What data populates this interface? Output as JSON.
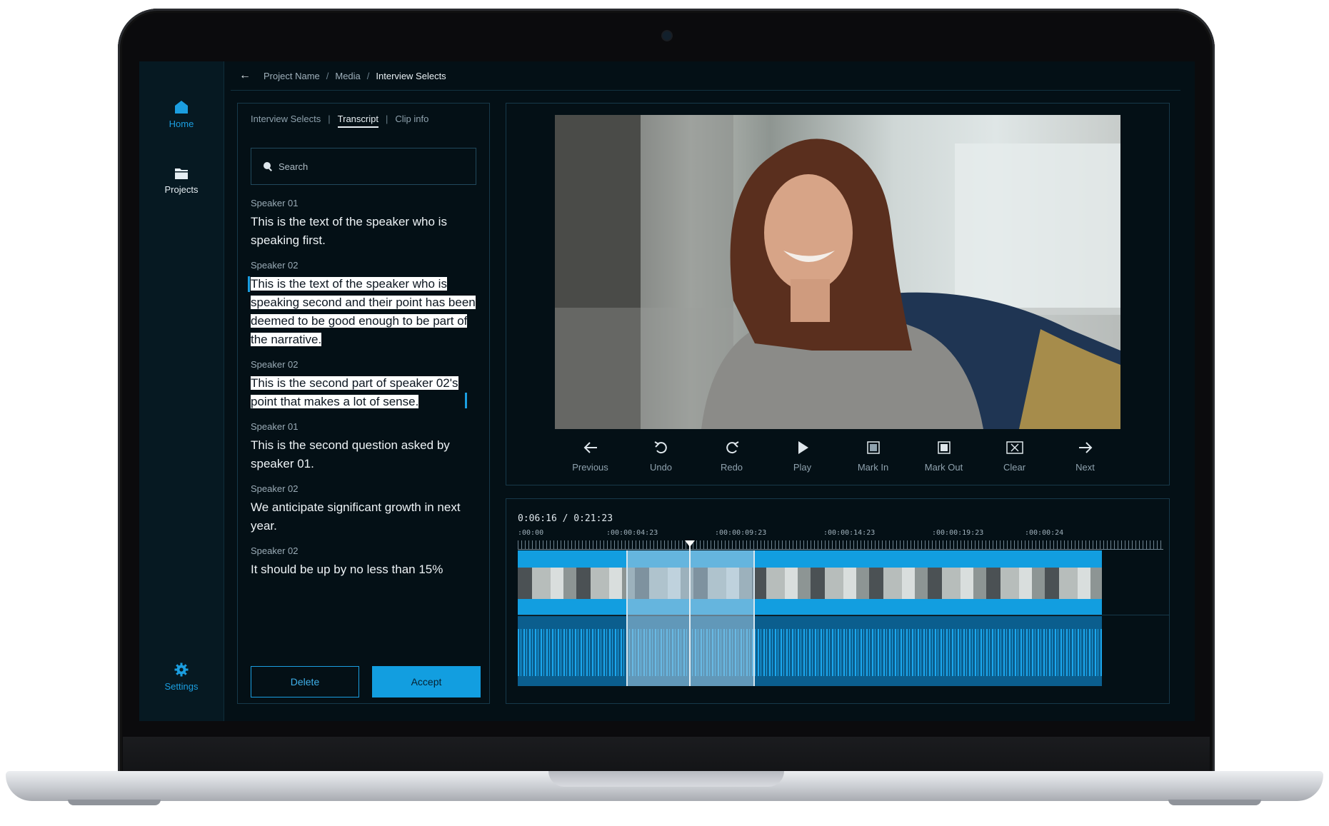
{
  "sidebar": {
    "home_label": "Home",
    "projects_label": "Projects",
    "settings_label": "Settings"
  },
  "breadcrumb": {
    "items": [
      "Project Name",
      "Media",
      "Interview Selects"
    ]
  },
  "transcript_panel": {
    "tabs": [
      "Interview Selects",
      "Transcript",
      "Clip info"
    ],
    "active_tab": "Transcript",
    "search_placeholder": "Search",
    "entries": [
      {
        "speaker": "Speaker 01",
        "text": "This is the text of the speaker who is speaking first.",
        "highlighted": false
      },
      {
        "speaker": "Speaker 02",
        "text": "This is the text of the speaker who is speaking second and their point has been deemed to be good enough to be part of the narrative.",
        "highlighted": true
      },
      {
        "speaker": "Speaker 02",
        "text": "This is the second part of speaker 02's point that makes a lot of sense.",
        "highlighted": true
      },
      {
        "speaker": "Speaker 01",
        "text": "This is the second question asked by speaker 01.",
        "highlighted": false
      },
      {
        "speaker": "Speaker 02",
        "text": "We anticipate significant growth in next year.",
        "highlighted": false
      },
      {
        "speaker": "Speaker 02",
        "text": "It should be up by no less than 15%",
        "highlighted": false
      }
    ],
    "delete_label": "Delete",
    "accept_label": "Accept"
  },
  "video_controls": [
    {
      "label": "Previous",
      "icon": "arrow-left-icon"
    },
    {
      "label": "Undo",
      "icon": "undo-icon"
    },
    {
      "label": "Redo",
      "icon": "redo-icon"
    },
    {
      "label": "Play",
      "icon": "play-icon"
    },
    {
      "label": "Mark In",
      "icon": "mark-in-icon"
    },
    {
      "label": "Mark Out",
      "icon": "mark-out-icon"
    },
    {
      "label": "Clear",
      "icon": "clear-icon"
    },
    {
      "label": "Next",
      "icon": "arrow-right-icon"
    }
  ],
  "timeline": {
    "timecode": "0:06:16 / 0:21:23",
    "ruler_labels": [
      ":00:00",
      ":00:00:04:23",
      ":00:00:09:23",
      ":00:00:14:23",
      ":00:00:19:23",
      ":00:00:24"
    ]
  },
  "colors": {
    "accent": "#129ee0",
    "background": "#041016",
    "panel_border": "#17394a"
  }
}
